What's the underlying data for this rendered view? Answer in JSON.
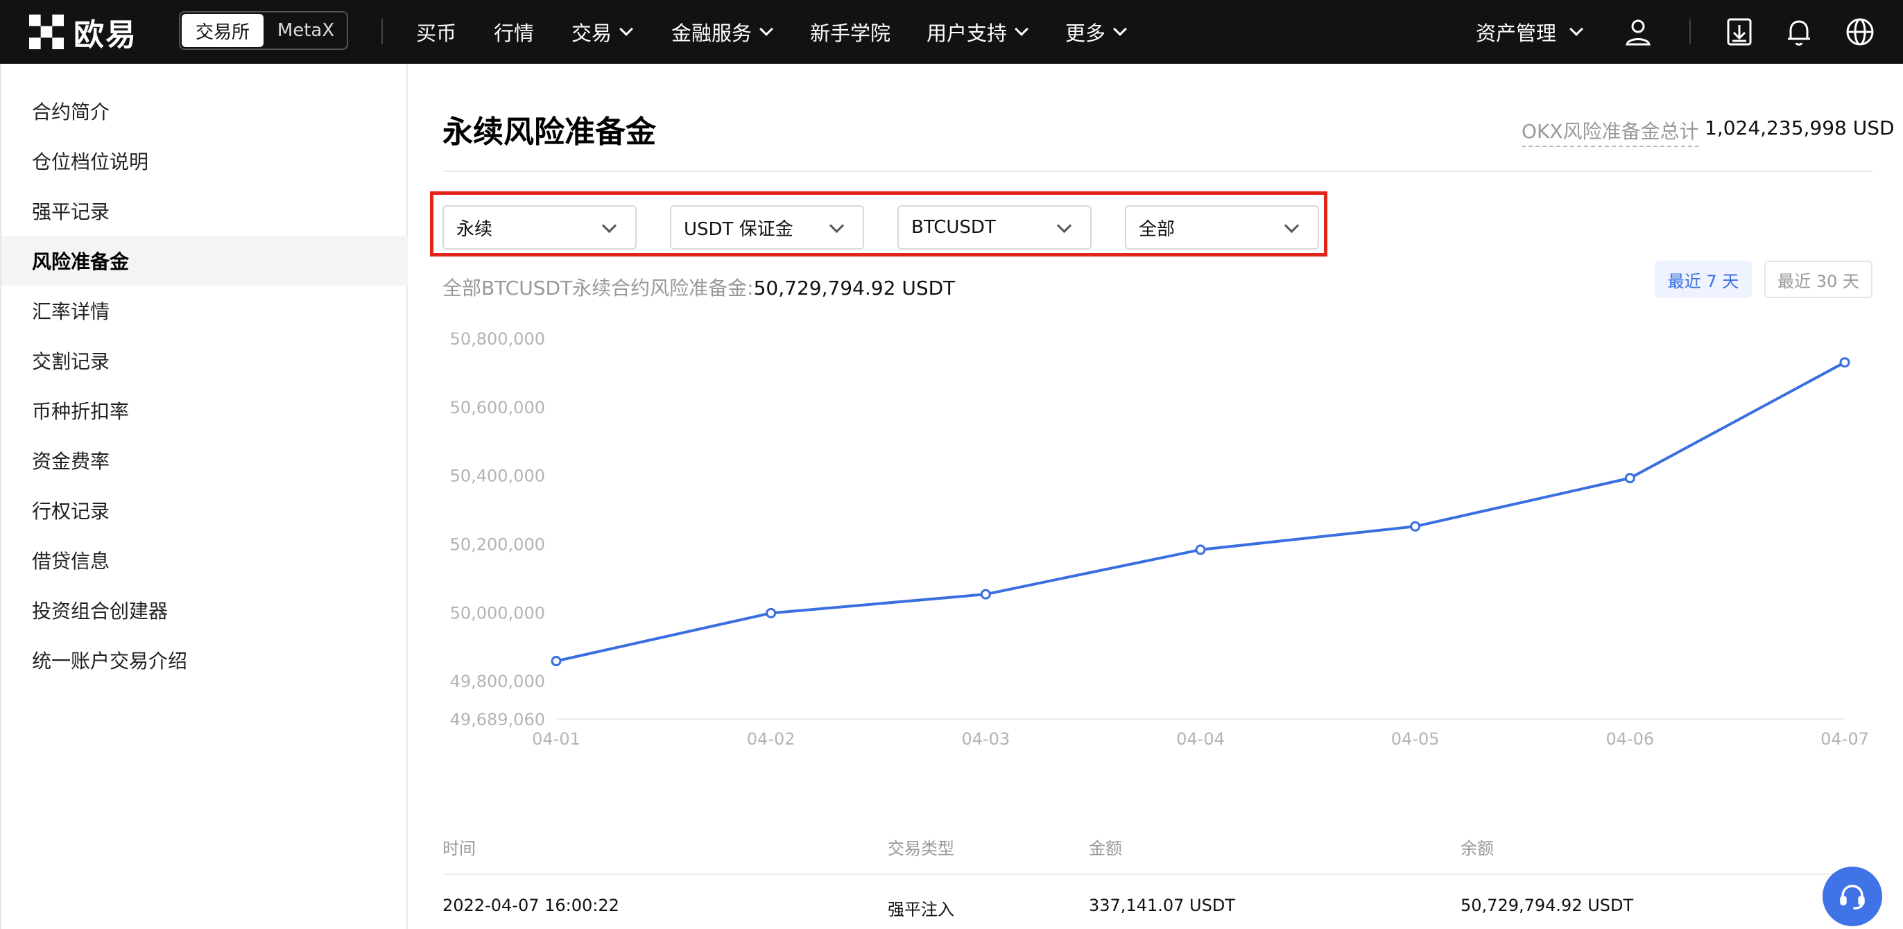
{
  "nav": {
    "brand": "欧易",
    "switch": [
      "交易所",
      "MetaX"
    ],
    "links": [
      {
        "label": "买币",
        "dropdown": false
      },
      {
        "label": "行情",
        "dropdown": false
      },
      {
        "label": "交易",
        "dropdown": true
      },
      {
        "label": "金融服务",
        "dropdown": true
      },
      {
        "label": "新手学院",
        "dropdown": false
      },
      {
        "label": "用户支持",
        "dropdown": true
      },
      {
        "label": "更多",
        "dropdown": true
      }
    ],
    "assets": "资产管理",
    "icons": [
      "user-icon",
      "download-icon",
      "bell-icon",
      "globe-icon"
    ]
  },
  "sidebar": {
    "active_index": 3,
    "items": [
      "合约简介",
      "仓位档位说明",
      "强平记录",
      "风险准备金",
      "汇率详情",
      "交割记录",
      "币种折扣率",
      "资金费率",
      "行权记录",
      "借贷信息",
      "投资组合创建器",
      "统一账户交易介绍"
    ]
  },
  "header": {
    "title": "永续风险准备金",
    "total_label": "OKX风险准备金总计",
    "total_value": "1,024,235,998 USD"
  },
  "filters": [
    "永续",
    "USDT 保证金",
    "BTCUSDT",
    "全部"
  ],
  "summary": {
    "label": "全部BTCUSDT永续合约风险准备金:",
    "value": "50,729,794.92 USDT"
  },
  "range": {
    "recent7": "最近 7 天",
    "recent30": "最近 30 天",
    "active": "recent7"
  },
  "chart_data": {
    "type": "line",
    "categories": [
      "04-01",
      "04-02",
      "04-03",
      "04-04",
      "04-05",
      "04-06",
      "04-07"
    ],
    "values": [
      49858000,
      49998000,
      50053000,
      50183000,
      50251000,
      50392000,
      50729794.92
    ],
    "yticks": [
      "50,800,000",
      "50,600,000",
      "50,400,000",
      "50,200,000",
      "50,000,000",
      "49,800,000",
      "49,689,060"
    ],
    "ylim": [
      49689060,
      50800000
    ],
    "line_color": "#3a6fe0",
    "grid": false
  },
  "table": {
    "headers": [
      "时间",
      "交易类型",
      "金额",
      "余额"
    ],
    "rows": [
      [
        "2022-04-07 16:00:22",
        "强平注入",
        "337,141.07 USDT",
        "50,729,794.92 USDT"
      ]
    ]
  },
  "support_icon": "headset-icon"
}
